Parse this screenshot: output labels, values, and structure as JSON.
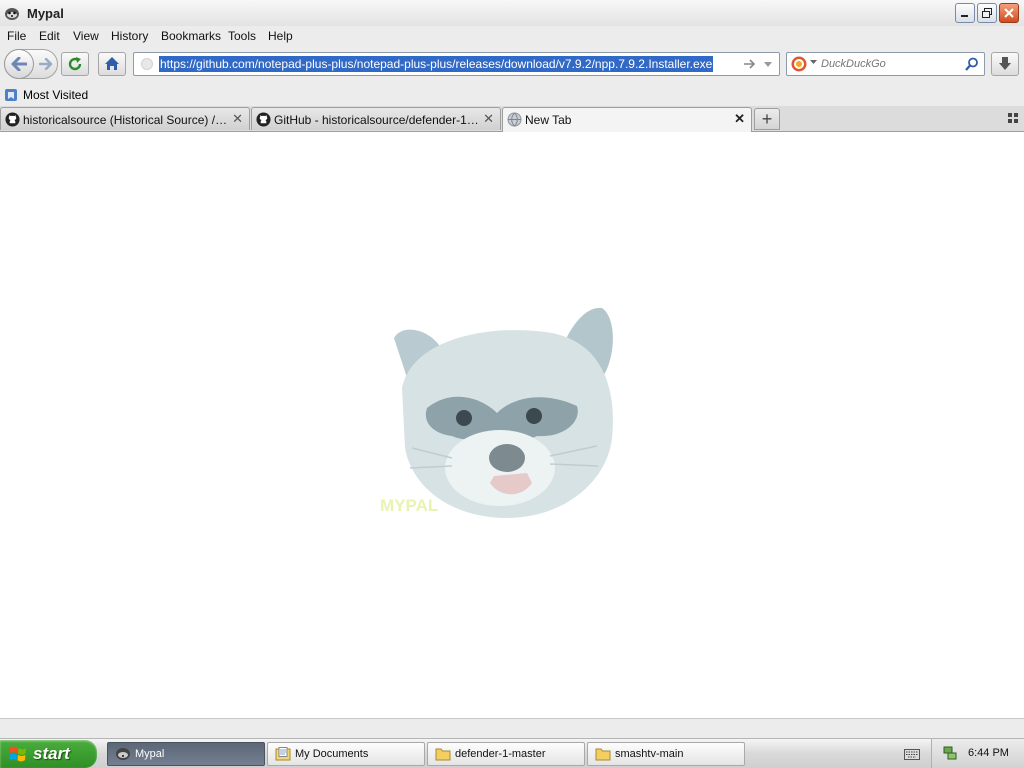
{
  "window": {
    "title": "Mypal"
  },
  "menu": [
    "File",
    "Edit",
    "View",
    "History",
    "Bookmarks",
    "Tools",
    "Help"
  ],
  "address_bar": {
    "url": "https://github.com/notepad-plus-plus/notepad-plus-plus/releases/download/v7.9.2/npp.7.9.2.Installer.exe"
  },
  "search": {
    "placeholder": "DuckDuckGo"
  },
  "bookmarks": {
    "most_visited": "Most Visited"
  },
  "tabs": [
    {
      "label": "historicalsource (Historical Source) / Rep...",
      "icon": "github-icon"
    },
    {
      "label": "GitHub - historicalsource/defender-1: Def...",
      "icon": "github-icon"
    },
    {
      "label": "New Tab",
      "icon": "globe-icon",
      "active": true
    }
  ],
  "content": {
    "brand_text": "MYPAL"
  },
  "taskbar": {
    "start": "start",
    "tasks": [
      {
        "label": "Mypal",
        "icon": "mypal-icon",
        "active": true
      },
      {
        "label": "My Documents",
        "icon": "documents-icon"
      },
      {
        "label": "defender-1-master",
        "icon": "folder-icon"
      },
      {
        "label": "smashtv-main",
        "icon": "folder-icon"
      }
    ],
    "clock": "6:44 PM"
  },
  "colors": {
    "url_selection": "#3169c6",
    "start_green": "#3a9d2e",
    "active_task": "#677283"
  }
}
